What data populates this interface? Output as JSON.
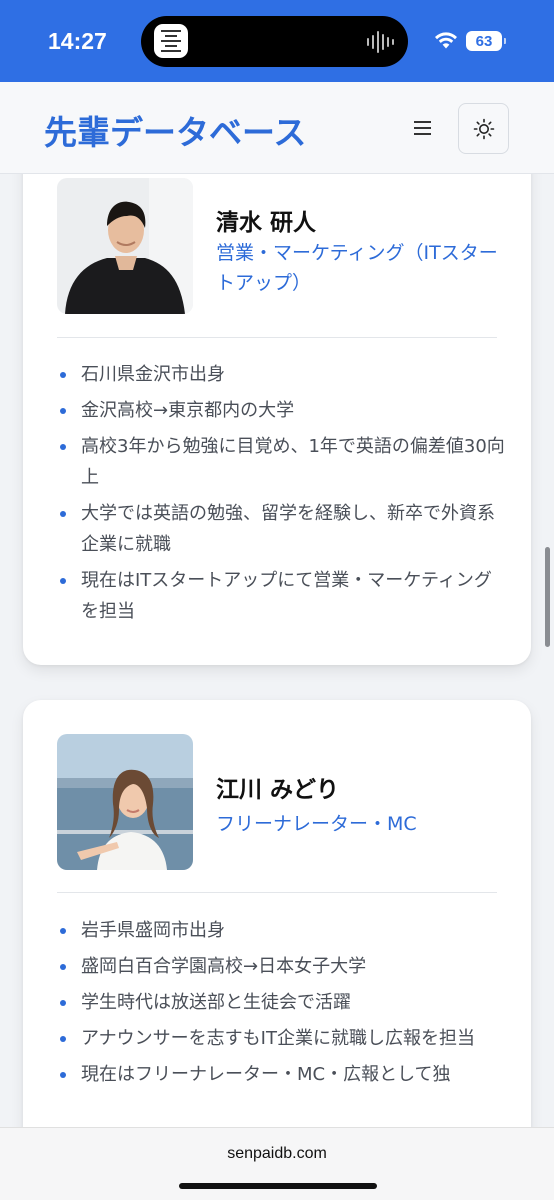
{
  "status_bar": {
    "time": "14:27",
    "battery": "63",
    "background_color": "#2f6fe4"
  },
  "header": {
    "title": "先輩データベース",
    "menu_icon": "hamburger-menu-icon",
    "theme_icon": "sun-icon",
    "accent_color": "#2d6bd8"
  },
  "profiles": [
    {
      "name": "清水 研人",
      "role": "営業・マーケティング（ITスタートアップ）",
      "bio": [
        "石川県金沢市出身",
        "金沢高校→東京都内の大学",
        "高校3年から勉強に目覚め、1年で英語の偏差値30向上",
        "大学では英語の勉強、留学を経験し、新卒で外資系企業に就職",
        "現在はITスタートアップにて営業・マーケティングを担当"
      ]
    },
    {
      "name": "江川 みどり",
      "role": "フリーナレーター・MC",
      "bio": [
        "岩手県盛岡市出身",
        "盛岡白百合学園高校→日本女子大学",
        "学生時代は放送部と生徒会で活躍",
        "アナウンサーを志すもIT企業に就職し広報を担当",
        "現在はフリーナレーター・MC・広報として独"
      ]
    }
  ],
  "browser": {
    "url": "senpaidb.com"
  }
}
